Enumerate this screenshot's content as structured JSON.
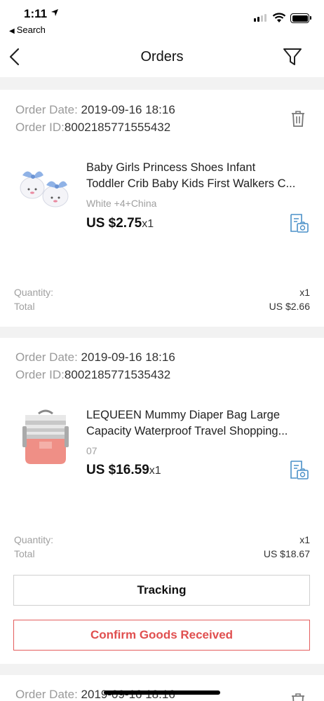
{
  "status_bar": {
    "time": "1:11",
    "back_app": "Search"
  },
  "nav": {
    "title": "Orders"
  },
  "labels": {
    "order_date": "Order Date:",
    "order_id": "Order ID:",
    "quantity": "Quantity:",
    "total": "Total"
  },
  "orders": [
    {
      "date": "2019-09-16 18:16",
      "id": "8002185771555432",
      "product_title_line1": "Baby Girls Princess Shoes Infant",
      "product_title_line2": "Toddler Crib Baby Kids First Walkers C...",
      "variant": "White +4+China",
      "price": "US $2.75",
      "qty_suffix": "x1",
      "quantity": "x1",
      "total": "US $2.66"
    },
    {
      "date": "2019-09-16 18:16",
      "id": "8002185771535432",
      "product_title_line1": "LEQUEEN Mummy Diaper Bag Large",
      "product_title_line2": "Capacity Waterproof Travel Shopping...",
      "variant": "07",
      "price": "US $16.59",
      "qty_suffix": "x1",
      "quantity": "x1",
      "total": "US $18.67",
      "buttons": {
        "tracking": "Tracking",
        "confirm": "Confirm Goods Received"
      }
    },
    {
      "date": "2019-09-16 18:16"
    }
  ],
  "colors": {
    "accent_red": "#e04f4f",
    "icon_blue": "#4a90c8",
    "separator": "#f2f2f2"
  }
}
